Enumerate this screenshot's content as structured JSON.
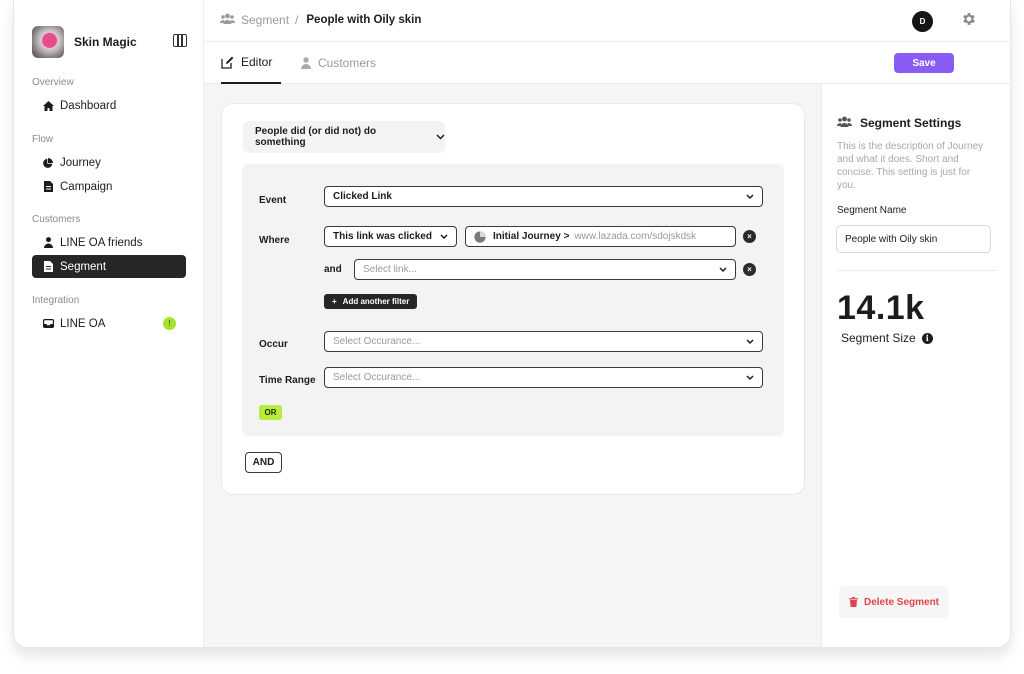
{
  "brand": {
    "name": "Skin Magic"
  },
  "sidebar": {
    "sections": [
      {
        "label": "Overview"
      },
      {
        "label": "Flow"
      },
      {
        "label": "Customers"
      },
      {
        "label": "Integration"
      }
    ],
    "items": [
      {
        "label": "Dashboard",
        "icon": "home-icon"
      },
      {
        "label": "Journey",
        "icon": "pie-icon"
      },
      {
        "label": "Campaign",
        "icon": "document-icon"
      },
      {
        "label": "LINE OA friends",
        "icon": "person-icon"
      },
      {
        "label": "Segment",
        "icon": "document-icon",
        "active": true
      },
      {
        "label": "LINE OA",
        "icon": "inbox-icon",
        "badge": "!"
      }
    ]
  },
  "header": {
    "breadcrumb_parent": "Segment",
    "breadcrumb_sep": "/",
    "breadcrumb_current": "People with Oily skin",
    "avatar_initial": "D"
  },
  "tabs": [
    {
      "label": "Editor",
      "active": true
    },
    {
      "label": "Customers",
      "active": false
    }
  ],
  "toolbar": {
    "save_label": "Save"
  },
  "editor": {
    "trigger_label": "People did (or did not) do something",
    "event_label": "Event",
    "event_value": "Clicked Link",
    "where_label": "Where",
    "where_condition": "This link was clicked",
    "link_journey": "Initial Journey >",
    "link_url": "www.lazada.com/sdojskdsk",
    "and_label": "and",
    "select_link_placeholder": "Select link...",
    "add_filter_label": "Add another filter",
    "occur_label": "Occur",
    "occur_placeholder": "Select Occurance...",
    "time_range_label": "Time Range",
    "time_range_placeholder": "Select Occurance...",
    "or_label": "OR",
    "and_button_label": "AND"
  },
  "settings": {
    "title": "Segment Settings",
    "description": "This is the description of Journey and what it does. Short and concise. This setting is just for you.",
    "name_label": "Segment Name",
    "name_value": "People with Oily skin",
    "size_value": "14.1k",
    "size_label": "Segment Size",
    "delete_label": "Delete Segment"
  },
  "colors": {
    "accent": "#8a5cf6",
    "or_green": "#b7eb3c",
    "danger": "#e0454f",
    "active_nav": "#262626"
  }
}
